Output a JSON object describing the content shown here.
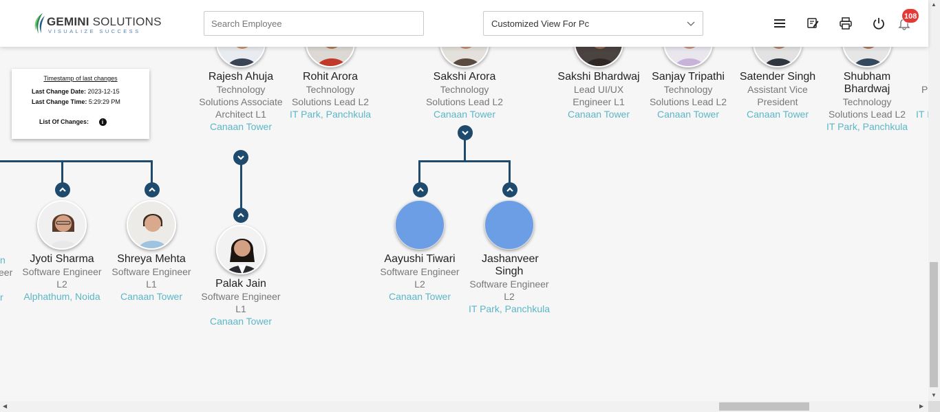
{
  "header": {
    "logo_brand": "GEMINI",
    "logo_brand2": " SOLUTIONS",
    "logo_tagline": "VISUALIZE SUCCESS",
    "search_placeholder": "Search Employee",
    "view_select": "Customized View For Pc",
    "notification_count": "108",
    "icons": [
      "menu-icon",
      "edit-note-icon",
      "print-icon",
      "power-icon",
      "bell-icon"
    ]
  },
  "timestamp_box": {
    "title": "Timestamp of last changes",
    "date_label": "Last Change Date:",
    "date_value": "2023-12-15",
    "time_label": "Last Change Time:",
    "time_value": "5:29:29 PM",
    "changes_label": "List Of Changes:"
  },
  "top_row": [
    {
      "name": "Rajesh Ahuja",
      "designation": "Technology Solutions Associate Architect L1",
      "location": "Canaan Tower"
    },
    {
      "name": "Rohit Arora",
      "designation": "Technology Solutions Lead L2",
      "location": "IT Park, Panchkula"
    },
    {
      "name": "Sakshi Arora",
      "designation": "Technology Solutions Lead L2",
      "location": "Canaan Tower"
    },
    {
      "name": "Sakshi Bhardwaj",
      "designation": "Lead UI/UX Engineer L1",
      "location": "Canaan Tower"
    },
    {
      "name": "Sanjay Tripathi",
      "designation": "Technology Solutions Lead L2",
      "location": "Canaan Tower"
    },
    {
      "name": "Satender Singh",
      "designation": "Assistant Vice President",
      "location": "Canaan Tower"
    },
    {
      "name": "Shubham Bhardwaj",
      "designation": "Technology Solutions Lead L2",
      "location": "IT Park, Panchkula"
    }
  ],
  "bottom_row": [
    {
      "name": "Jyoti Sharma",
      "designation": "Software Engineer L2",
      "location": "Alphathum, Noida"
    },
    {
      "name": "Shreya Mehta",
      "designation": "Software Engineer L1",
      "location": "Canaan Tower"
    },
    {
      "name": "Palak Jain",
      "designation": "Software Engineer L1",
      "location": "Canaan Tower"
    },
    {
      "name": "Aayushi Tiwari",
      "designation": "Software Engineer L2",
      "location": "Canaan Tower"
    },
    {
      "name": "Jashanveer Singh",
      "designation": "Software Engineer L2",
      "location": "IT Park, Panchkula"
    }
  ],
  "partials": {
    "left_1": "n",
    "left_2": "eer",
    "left_3": "r",
    "right_1": "P",
    "right_2": "IT I"
  },
  "colors": {
    "connector": "#1e4a6e",
    "location": "#5cb6c6",
    "badge": "#e53935",
    "placeholder_avatar": "#6c9ee6"
  }
}
